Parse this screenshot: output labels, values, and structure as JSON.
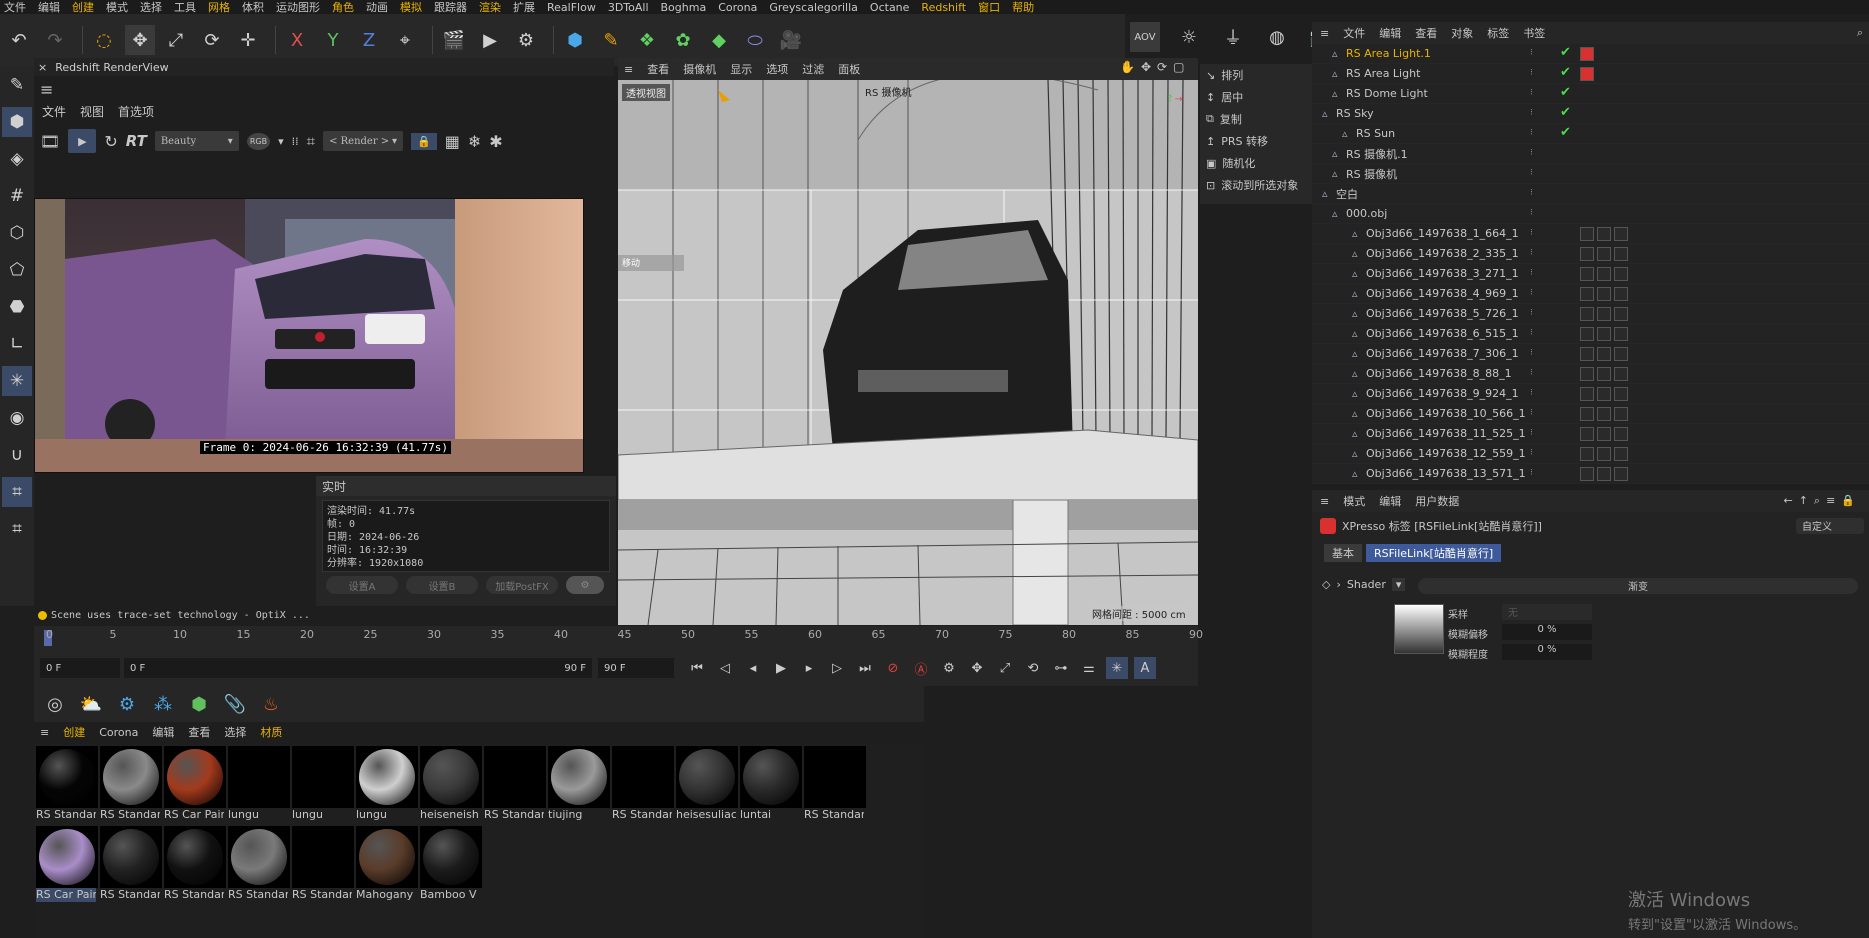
{
  "menubar": [
    "文件",
    "编辑",
    "创建",
    "模式",
    "选择",
    "工具",
    "网格",
    "体积",
    "运动图形",
    "角色",
    "动画",
    "模拟",
    "跟踪器",
    "渲染",
    "扩展",
    "RealFlow",
    "3DToAll",
    "Boghma",
    "Corona",
    "Greyscalegorilla",
    "Octane",
    "Redshift",
    "窗口",
    "帮助"
  ],
  "toolbar": {
    "x": "X",
    "y": "Y",
    "z": "Z"
  },
  "renderview": {
    "title": "Redshift RenderView",
    "menu": [
      "文件",
      "视图",
      "首选项"
    ],
    "rt": "RT",
    "aov": "Beauty",
    "rgb": "RGB",
    "render_dd": "< Render >",
    "frame_caption": "Frame  0:  2024-06-26  16:32:39  (41.77s)",
    "stats_title": "实时",
    "stats_lines": [
      "渲染时间: 41.77s",
      "帧: 0",
      "日期: 2024-06-26",
      "时间: 16:32:39",
      "分辨率: 1920x1080"
    ],
    "buttons": [
      "设置A",
      "设置B",
      "加载PostFX"
    ],
    "status": "Scene uses trace-set technology - OptiX ..."
  },
  "viewport": {
    "menu": [
      "查看",
      "摄像机",
      "显示",
      "选项",
      "过滤",
      "面板"
    ],
    "label": "透视视图",
    "camera": "RS 摄像机",
    "move_label": "移动",
    "scale": "网格间距 : 5000 cm"
  },
  "context_menu": [
    "排列",
    "居中",
    "复制",
    "PRS 转移",
    "随机化",
    "滚动到所选对象"
  ],
  "objmgr": {
    "menu": [
      "文件",
      "编辑",
      "查看",
      "对象",
      "标签",
      "书签"
    ],
    "rows": [
      {
        "name": "RS Area Light.1",
        "indent": 1,
        "highlight": true,
        "check": true
      },
      {
        "name": "RS Area Light",
        "indent": 1,
        "check": true
      },
      {
        "name": "RS Dome Light",
        "indent": 1,
        "check": true
      },
      {
        "name": "RS Sky",
        "indent": 0,
        "check": true
      },
      {
        "name": "RS Sun",
        "indent": 2,
        "check": true
      },
      {
        "name": "RS 摄像机.1",
        "indent": 1
      },
      {
        "name": "RS 摄像机",
        "indent": 1
      },
      {
        "name": "空白",
        "indent": 0
      },
      {
        "name": "000.obj",
        "indent": 1
      },
      {
        "name": "Obj3d66_1497638_1_664_1",
        "indent": 3
      },
      {
        "name": "Obj3d66_1497638_2_335_1",
        "indent": 3
      },
      {
        "name": "Obj3d66_1497638_3_271_1",
        "indent": 3
      },
      {
        "name": "Obj3d66_1497638_4_969_1",
        "indent": 3
      },
      {
        "name": "Obj3d66_1497638_5_726_1",
        "indent": 3
      },
      {
        "name": "Obj3d66_1497638_6_515_1",
        "indent": 3
      },
      {
        "name": "Obj3d66_1497638_7_306_1",
        "indent": 3
      },
      {
        "name": "Obj3d66_1497638_8_88_1",
        "indent": 3
      },
      {
        "name": "Obj3d66_1497638_9_924_1",
        "indent": 3
      },
      {
        "name": "Obj3d66_1497638_10_566_1",
        "indent": 3
      },
      {
        "name": "Obj3d66_1497638_11_525_1",
        "indent": 3
      },
      {
        "name": "Obj3d66_1497638_12_559_1",
        "indent": 3
      },
      {
        "name": "Obj3d66_1497638_13_571_1",
        "indent": 3
      }
    ]
  },
  "attr": {
    "menu": [
      "模式",
      "编辑",
      "用户数据"
    ],
    "title": "XPresso 标签 [RSFileLink[站酷肖意行]]",
    "custom": "自定义",
    "tabs": [
      "基本",
      "RSFileLink[站酷肖意行]"
    ],
    "shader_label": "Shader",
    "gradient_label": "渐变",
    "sample_label": "采样",
    "sample_value": "无",
    "blur_offset_label": "模糊偏移",
    "blur_offset_value": "0 %",
    "blur_scale_label": "模糊程度",
    "blur_scale_value": "0 %"
  },
  "timeline": {
    "ticks": [
      "0",
      "5",
      "10",
      "15",
      "20",
      "25",
      "30",
      "35",
      "40",
      "45",
      "50",
      "55",
      "60",
      "65",
      "70",
      "75",
      "80",
      "85",
      "90"
    ],
    "start": "0 F",
    "current": "0 F",
    "end_inner": "90 F",
    "end": "90 F"
  },
  "materials": {
    "menu": [
      "创建",
      "Corona",
      "编辑",
      "查看",
      "选择",
      "材质"
    ],
    "items": [
      {
        "name": "RS Standar",
        "color": "#050505"
      },
      {
        "name": "RS Standar",
        "color": "#8a8a8a"
      },
      {
        "name": "RS Car Pair",
        "color": "#a33a1c"
      },
      {
        "name": "lungu",
        "color": "#000000"
      },
      {
        "name": "lungu",
        "color": "#000000"
      },
      {
        "name": "lungu",
        "color": "#cfcfcf"
      },
      {
        "name": "heiseneish",
        "color": "#3a3a3a"
      },
      {
        "name": "RS Standar",
        "color": "#000000"
      },
      {
        "name": "tiujing",
        "color": "#9a9a9a"
      },
      {
        "name": "RS Standar",
        "color": "#000000"
      },
      {
        "name": "heisesuliac",
        "color": "#333333"
      },
      {
        "name": "luntai",
        "color": "#2a2a2a"
      },
      {
        "name": "RS Standar",
        "color": "#000000"
      },
      {
        "name": "RS Car Pair",
        "color": "#a98ec8"
      },
      {
        "name": "RS Standar",
        "color": "#222222"
      },
      {
        "name": "RS Standar",
        "color": "#111111"
      },
      {
        "name": "RS Standar",
        "color": "#7a7a7a"
      },
      {
        "name": "RS Standar",
        "color": "#000000"
      },
      {
        "name": "Mahogany",
        "color": "#5a3c2a"
      },
      {
        "name": "Bamboo V",
        "color": "#1c1c1c"
      }
    ]
  },
  "windows": {
    "line1": "激活 Windows",
    "line2": "转到\"设置\"以激活 Windows。"
  }
}
